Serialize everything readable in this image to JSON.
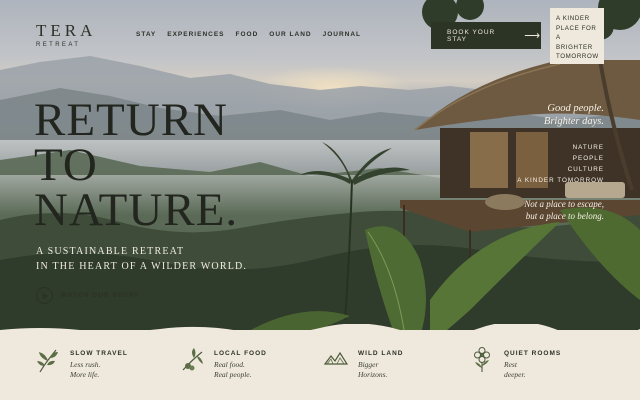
{
  "brand": {
    "name": "TERA",
    "tagline": "RETREAT"
  },
  "nav": [
    {
      "label": "STAY"
    },
    {
      "label": "EXPERIENCES"
    },
    {
      "label": "FOOD"
    },
    {
      "label": "OUR LAND"
    },
    {
      "label": "JOURNAL"
    }
  ],
  "cta": {
    "label": "BOOK YOUR STAY",
    "icon": "arrow-right-icon"
  },
  "note": {
    "lines": [
      "A KINDER",
      "PLACE FOR",
      "A",
      "BRIGHTER",
      "TOMORROW"
    ]
  },
  "hero": {
    "headline": [
      "RETURN",
      "TO",
      "NATURE."
    ],
    "subheadline": [
      "A SUSTAINABLE RETREAT",
      "IN THE HEART OF A WILDER WORLD."
    ],
    "video_link": {
      "label": "WATCH OUR STORY",
      "icon": "play-icon"
    }
  },
  "aside": {
    "quote": [
      "Good people.",
      "Brighter days."
    ],
    "values": [
      "NATURE",
      "PEOPLE",
      "CULTURE",
      "A KINDER TOMORROW"
    ],
    "tagline": [
      "Not a place to escape,",
      "but a place to belong."
    ]
  },
  "features": [
    {
      "title": "SLOW TRAVEL",
      "lines": [
        "Less rush.",
        "More life."
      ],
      "icon": "leaf-branch-icon"
    },
    {
      "title": "LOCAL FOOD",
      "lines": [
        "Real food.",
        "Real people."
      ],
      "icon": "olive-branch-icon"
    },
    {
      "title": "WILD LAND",
      "lines": [
        "Bigger",
        "Horizons."
      ],
      "icon": "mountain-icon"
    },
    {
      "title": "QUIET ROOMS",
      "lines": [
        "Rest",
        "deeper."
      ],
      "icon": "flower-icon"
    }
  ],
  "colors": {
    "dark": "#2c3426",
    "cream": "#efe8dc",
    "text": "#22261f"
  }
}
